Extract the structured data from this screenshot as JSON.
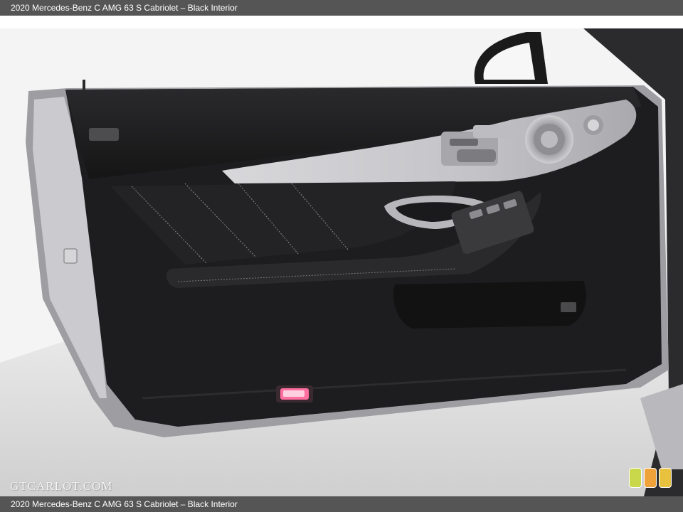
{
  "caption": {
    "top": "2020 Mercedes-Benz C AMG 63 S Cabriolet – Black Interior",
    "bottom": "2020 Mercedes-Benz C AMG 63 S Cabriolet – Black Interior"
  },
  "watermark": {
    "text": "GTCARLOT.COM"
  },
  "logo": {
    "colors": [
      "#c8d84a",
      "#f0a23a",
      "#e8c13e"
    ]
  },
  "photo": {
    "subject": "door-panel-interior",
    "colors": {
      "door_leather": "#1c1c1e",
      "door_trim": "#c9c9cc",
      "puddle_light": "#ff6fa0",
      "floor": "#d9d9d9"
    }
  }
}
